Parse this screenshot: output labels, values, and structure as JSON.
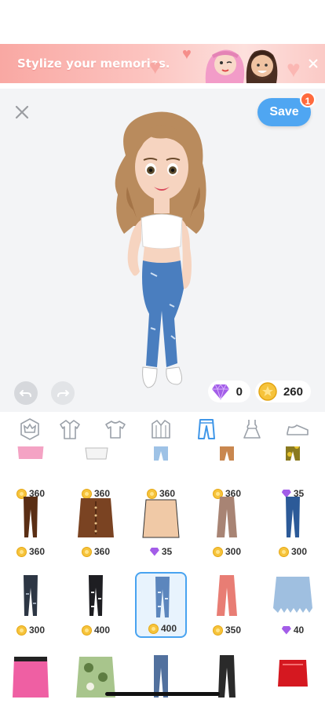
{
  "banner": {
    "text": "Stylize your memories."
  },
  "toolbar": {
    "save_label": "Save",
    "save_badge": "1"
  },
  "currency": {
    "gems": "0",
    "coins": "260"
  },
  "categories": [
    {
      "icon": "crown-icon",
      "active": false
    },
    {
      "icon": "jacket-icon",
      "active": false
    },
    {
      "icon": "tshirt-icon",
      "active": false
    },
    {
      "icon": "coat-icon",
      "active": false
    },
    {
      "icon": "pants-icon",
      "active": true
    },
    {
      "icon": "dress-icon",
      "active": false
    },
    {
      "icon": "shoe-icon",
      "active": false
    }
  ],
  "items": [
    {
      "name": "pink-shorts",
      "price": "360",
      "currency": "coin",
      "color": "#f4a3c4"
    },
    {
      "name": "white-shorts",
      "price": "360",
      "currency": "coin",
      "color": "#e6e6e6"
    },
    {
      "name": "light-jeans-shorts",
      "price": "360",
      "currency": "coin",
      "color": "#9ec2e6"
    },
    {
      "name": "tan-pants",
      "price": "360",
      "currency": "coin",
      "color": "#c9874f"
    },
    {
      "name": "camo-pants",
      "price": "35",
      "currency": "gem",
      "color": "#8a7a1f"
    },
    {
      "name": "brown-leggings",
      "price": "360",
      "currency": "coin",
      "color": "#5a2e14"
    },
    {
      "name": "brown-button-skirt",
      "price": "360",
      "currency": "coin",
      "color": "#7a4322"
    },
    {
      "name": "beige-skirt",
      "price": "35",
      "currency": "gem",
      "color": "#f0c9a6"
    },
    {
      "name": "taupe-flare-pants",
      "price": "300",
      "currency": "coin",
      "color": "#a88474"
    },
    {
      "name": "blue-skinny-jeans",
      "price": "300",
      "currency": "coin",
      "color": "#2c5a98"
    },
    {
      "name": "dark-ripped-jeans",
      "price": "300",
      "currency": "coin",
      "color": "#2d3644"
    },
    {
      "name": "black-ripped-jeans",
      "price": "400",
      "currency": "coin",
      "color": "#1e1e22"
    },
    {
      "name": "blue-ripped-jeans",
      "price": "400",
      "currency": "coin",
      "color": "#5c86bd",
      "selected": true
    },
    {
      "name": "salmon-flare-pants",
      "price": "350",
      "currency": "coin",
      "color": "#e87d74"
    },
    {
      "name": "denim-fringe-skirt",
      "price": "40",
      "currency": "gem",
      "color": "#9fbfe0"
    },
    {
      "name": "pink-cargo-skirt",
      "price": "",
      "currency": "",
      "color": "#ef5fa3"
    },
    {
      "name": "camo-skirt",
      "price": "",
      "currency": "",
      "color": "#a8c58c"
    },
    {
      "name": "straight-jeans",
      "price": "",
      "currency": "",
      "color": "#52719e"
    },
    {
      "name": "black-flare-pants",
      "price": "",
      "currency": "",
      "color": "#2a2a2a"
    },
    {
      "name": "red-leather-skirt",
      "price": "",
      "currency": "",
      "color": "#d51820"
    }
  ]
}
